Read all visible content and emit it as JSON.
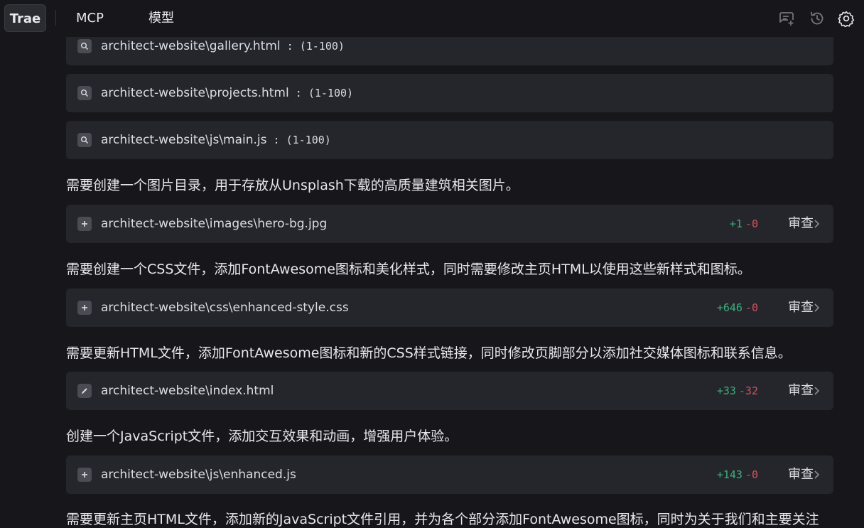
{
  "tabs": {
    "trae": "Trae",
    "mcp": "MCP",
    "model": "模型"
  },
  "icons": {
    "new_chat": "chat-plus-icon",
    "history": "history-icon",
    "settings": "gear-icon"
  },
  "review_label": "审查",
  "read_items": [
    {
      "path": "architect-website\\gallery.html",
      "range": " : (1-100)"
    },
    {
      "path": "architect-website\\projects.html",
      "range": " : (1-100)"
    },
    {
      "path": "architect-website\\js\\main.js",
      "range": " : (1-100)"
    }
  ],
  "messages": [
    "需要创建一个图片目录，用于存放从Unsplash下载的高质量建筑相关图片。",
    "需要创建一个CSS文件，添加FontAwesome图标和美化样式，同时需要修改主页HTML以使用这些新样式和图标。",
    "需要更新HTML文件，添加FontAwesome图标和新的CSS样式链接，同时修改页脚部分以添加社交媒体图标和联系信息。",
    "创建一个JavaScript文件，添加交互效果和动画，增强用户体验。",
    "需要更新主页HTML文件，添加新的JavaScript文件引用，并为各个部分添加FontAwesome图标，同时为关于我们和主要关注"
  ],
  "file_changes": [
    {
      "path": "architect-website\\images\\hero-bg.jpg",
      "kind": "add",
      "added": "+1",
      "removed": "-0"
    },
    {
      "path": "architect-website\\css\\enhanced-style.css",
      "kind": "add",
      "added": "+646",
      "removed": "-0"
    },
    {
      "path": "architect-website\\index.html",
      "kind": "edit",
      "added": "+33",
      "removed": "-32"
    },
    {
      "path": "architect-website\\js\\enhanced.js",
      "kind": "add",
      "added": "+143",
      "removed": "-0"
    }
  ]
}
